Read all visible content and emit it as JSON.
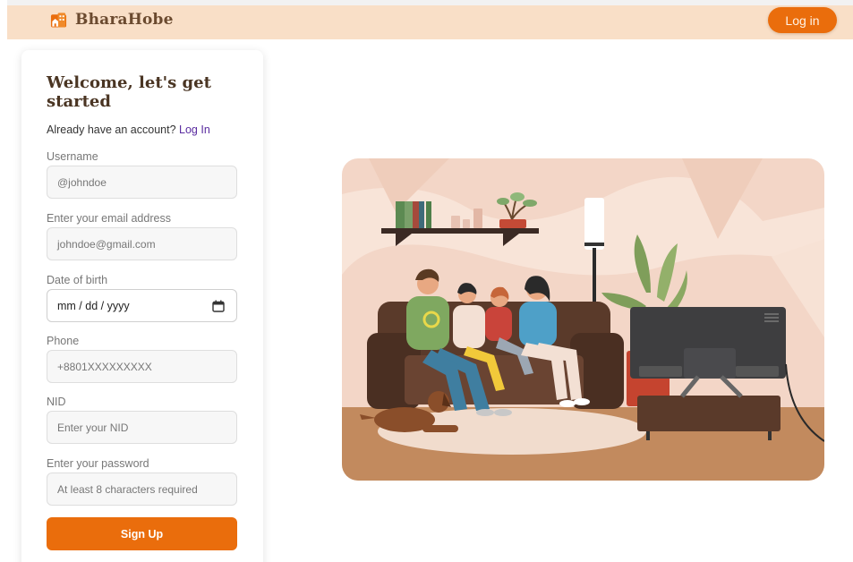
{
  "header": {
    "brand_name": "BharaHobe",
    "login_label": "Log in",
    "colors": {
      "bar": "#f9dfc7",
      "accent": "#ea6d0c",
      "brand_text": "#6b4a2f"
    }
  },
  "signup": {
    "title": "Welcome, let's get started",
    "have_account_text": "Already have an account?",
    "login_link": "Log In",
    "fields": [
      {
        "label": "Username",
        "placeholder": "@johndoe"
      },
      {
        "label": "Enter your email address",
        "placeholder": "johndoe@gmail.com"
      },
      {
        "label": "Date of birth",
        "placeholder": "mm / dd / yyyy"
      },
      {
        "label": "Phone",
        "placeholder": "+8801XXXXXXXXX"
      },
      {
        "label": "NID",
        "placeholder": "Enter your NID"
      },
      {
        "label": "Enter your password",
        "placeholder": "At least 8 characters required"
      }
    ],
    "submit_label": "Sign Up"
  },
  "illustration": {
    "subject": "family-on-couch-watching-tv"
  }
}
